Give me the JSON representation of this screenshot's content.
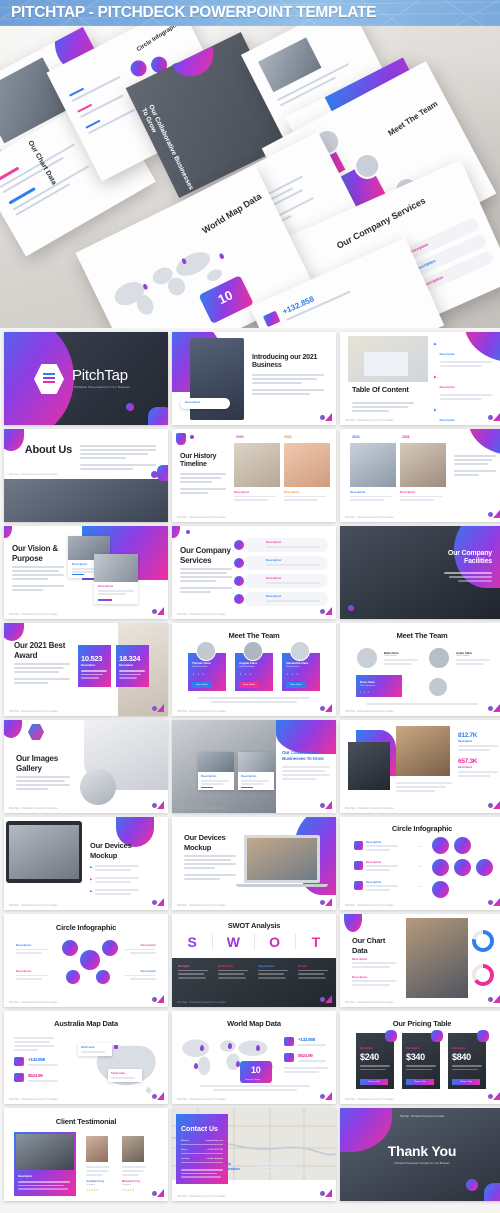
{
  "header": {
    "title": "PITCHTAP - PITCHDECK POWERPOINT TEMPLATE"
  },
  "hero": {
    "captions": [
      {
        "text": "Circle Infographic"
      },
      {
        "text": "Our Chart Data"
      },
      {
        "text": "Our Collaborative Businesses To Grow"
      },
      {
        "text": "Meet The Team"
      },
      {
        "text": "Our Company Services"
      },
      {
        "text": "World Map Data"
      },
      {
        "text": "Description"
      }
    ],
    "badge_number": "10",
    "stat": "+132.858"
  },
  "brand": {
    "name": "PitchTap",
    "tagline": "Pitchdeck Presentation For Your Business",
    "footer": "PitchTap - Pitchdeck Powerpoint Template",
    "accent_blue": "#2f7ef0",
    "accent_purple": "#8b3ee4",
    "accent_pink": "#f02f9e"
  },
  "slides": [
    {
      "id": "cover",
      "title": "PitchTap",
      "subtitle": "Pitchdeck Presentation For Your Business"
    },
    {
      "id": "introducing",
      "title": "Introducing our 2021 Business",
      "label": "Description"
    },
    {
      "id": "table-of-content",
      "title": "Table Of Content",
      "items": [
        {
          "label": "Description"
        },
        {
          "label": "Description"
        },
        {
          "label": "Description"
        },
        {
          "label": "Description"
        },
        {
          "label": "Description"
        }
      ]
    },
    {
      "id": "about-us",
      "title": "About Us"
    },
    {
      "id": "history-timeline",
      "title": "Our History Timeline",
      "years": [
        "2020",
        "2022"
      ],
      "label": "Description"
    },
    {
      "id": "history-timeline-2",
      "title": "Our History Timeline",
      "years": [
        "2023",
        "2026"
      ],
      "label": "Description"
    },
    {
      "id": "vision-purpose",
      "title": "Our Vision & Purpose",
      "labels": [
        "Description",
        "Description"
      ]
    },
    {
      "id": "company-services",
      "title": "Our Company Services",
      "items": [
        {
          "label": "Description"
        },
        {
          "label": "Description"
        },
        {
          "label": "Description"
        },
        {
          "label": "Description"
        }
      ]
    },
    {
      "id": "company-facilities",
      "title": "Our Company Facilities"
    },
    {
      "id": "best-award",
      "title": "Our 2021 Best Award",
      "stats": [
        {
          "value": "10.523",
          "label": "Description"
        },
        {
          "value": "18.324",
          "label": "Description"
        }
      ]
    },
    {
      "id": "meet-the-team-1",
      "title": "Meet The Team",
      "members": [
        {
          "name": "Thomas Clara",
          "role": "Chief Executive"
        },
        {
          "name": "Angelia Clara",
          "role": "Chief Marketing"
        },
        {
          "name": "Alexandria Clara",
          "role": "Chief Finance"
        }
      ],
      "cta": "More Detail"
    },
    {
      "id": "meet-the-team-2",
      "title": "Meet The Team",
      "members": [
        {
          "name": "Bella Clara",
          "role": "Chief Design"
        },
        {
          "name": "Andre Clara",
          "role": "Chief Product"
        },
        {
          "name": "Rose Clara",
          "role": "Chief Operation"
        }
      ],
      "cta": "More Detail"
    },
    {
      "id": "images-gallery",
      "title": "Our Images Gallery"
    },
    {
      "id": "collaborative",
      "title": "Our Collaborative Businesses To Grow",
      "labels": [
        "Description",
        "Description"
      ]
    },
    {
      "id": "facilities-stats",
      "stats": [
        {
          "value": "812.7K",
          "label": "Description",
          "color": "#2f7ef0"
        },
        {
          "value": "657.3K",
          "label": "Description",
          "color": "#ee2f9a"
        }
      ]
    },
    {
      "id": "devices-mockup-tablet",
      "title": "Our Devices Mockup",
      "bullets": [
        "Description",
        "Description",
        "Description"
      ]
    },
    {
      "id": "devices-mockup-laptop",
      "title": "Our Devices Mockup"
    },
    {
      "id": "circle-infographic-1",
      "title": "Circle Infographic",
      "rows": [
        {
          "label": "Description",
          "circles": 2
        },
        {
          "label": "Description",
          "circles": 3
        },
        {
          "label": "Description",
          "circles": 1
        }
      ]
    },
    {
      "id": "circle-infographic-2",
      "title": "Circle Infographic",
      "items": [
        {
          "label": "Description"
        },
        {
          "label": "Description"
        },
        {
          "label": "Description"
        },
        {
          "label": "Description"
        }
      ]
    },
    {
      "id": "swot",
      "title": "SWOT Analysis",
      "letters": [
        "S",
        "W",
        "O",
        "T"
      ],
      "columns": [
        {
          "label": "Strengths"
        },
        {
          "label": "Weaknesses"
        },
        {
          "label": "Opportunities"
        },
        {
          "label": "Threats"
        }
      ]
    },
    {
      "id": "chart-data",
      "title": "Our Chart Data",
      "labels": [
        "Description",
        "Description"
      ]
    },
    {
      "id": "australia-map",
      "title": "Australia Map Data",
      "stats": [
        {
          "value": "+132.858",
          "label": "Description"
        },
        {
          "value": "$524.99",
          "label": "Description"
        }
      ],
      "regions": [
        {
          "label": "North Area"
        },
        {
          "label": "South Area"
        }
      ]
    },
    {
      "id": "world-map",
      "title": "World Map Data",
      "badge": "10",
      "badge_label": "Regional Country",
      "stats": [
        {
          "value": "+132.858",
          "label": "Description"
        },
        {
          "value": "$524.99",
          "label": "Description"
        }
      ]
    },
    {
      "id": "pricing-table",
      "title": "Our Pricing Table",
      "plans": [
        {
          "label": "Description",
          "price": "$240",
          "cta": "Choose This"
        },
        {
          "label": "Description",
          "price": "$340",
          "cta": "Choose This"
        },
        {
          "label": "Description",
          "price": "$840",
          "cta": "Choose This"
        }
      ]
    },
    {
      "id": "client-testimonial",
      "title": "Client Testimonial",
      "label": "Description",
      "people": [
        {
          "name": "Jonathan Croy",
          "role": "Customer"
        },
        {
          "name": "Marianna Croy",
          "role": "Customer"
        }
      ]
    },
    {
      "id": "contact-map",
      "title": "Details Information"
    },
    {
      "id": "contact-us",
      "title": "Contact Us",
      "fields": [
        {
          "label": "Website",
          "value": "www.pitchtap.com"
        },
        {
          "label": "Phone",
          "value": "+1 234 5678 910"
        },
        {
          "label": "Location",
          "value": "London, England"
        }
      ]
    },
    {
      "id": "thank-you",
      "title": "Thank You",
      "subtitle": "Pitchdeck Presentation Template For Your Business"
    }
  ]
}
